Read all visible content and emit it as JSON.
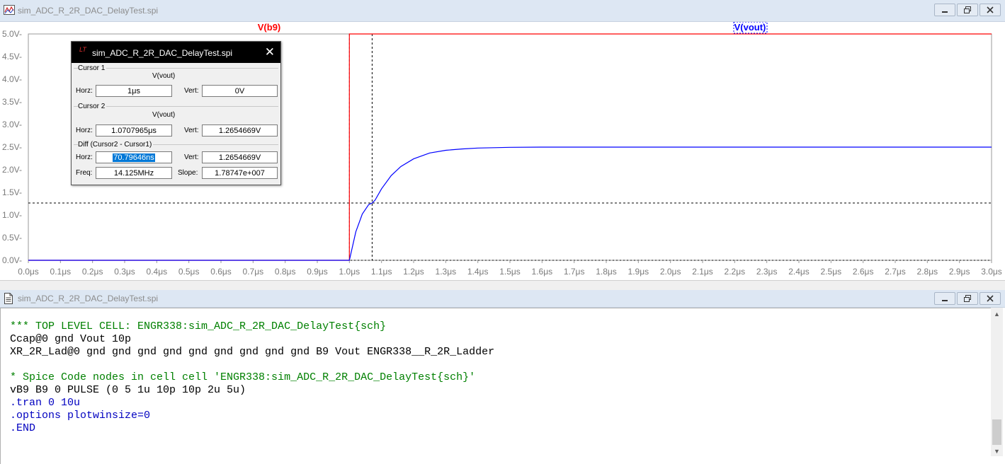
{
  "plot_window": {
    "title": "sim_ADC_R_2R_DAC_DelayTest.spi",
    "minimize_label": "—",
    "restore_label": "❐",
    "close_label": "✕"
  },
  "chart_data": {
    "type": "line",
    "title": "",
    "x_unit": "μs",
    "y_unit": "V",
    "xlim": [
      0.0,
      3.0
    ],
    "ylim": [
      0.0,
      5.0
    ],
    "x_ticks": [
      "0.0μs",
      "0.1μs",
      "0.2μs",
      "0.3μs",
      "0.4μs",
      "0.5μs",
      "0.6μs",
      "0.7μs",
      "0.8μs",
      "0.9μs",
      "1.0μs",
      "1.1μs",
      "1.2μs",
      "1.3μs",
      "1.4μs",
      "1.5μs",
      "1.6μs",
      "1.7μs",
      "1.8μs",
      "1.9μs",
      "2.0μs",
      "2.1μs",
      "2.2μs",
      "2.3μs",
      "2.4μs",
      "2.5μs",
      "2.6μs",
      "2.7μs",
      "2.8μs",
      "2.9μs",
      "3.0μs"
    ],
    "y_ticks": [
      "0.0V-",
      "0.5V-",
      "1.0V-",
      "1.5V-",
      "2.0V-",
      "2.5V-",
      "3.0V-",
      "3.5V-",
      "4.0V-",
      "4.5V-",
      "5.0V-"
    ],
    "series": [
      {
        "name": "V(b9)",
        "color": "#ff0000",
        "x": [
          0.0,
          1.0,
          1.0,
          3.0
        ],
        "y": [
          0.0,
          0.0,
          5.0,
          5.0
        ]
      },
      {
        "name": "V(vout)",
        "color": "#0000ff",
        "x": [
          0.0,
          1.0,
          1.02,
          1.04,
          1.06,
          1.0708,
          1.08,
          1.1,
          1.13,
          1.16,
          1.2,
          1.25,
          1.3,
          1.35,
          1.4,
          1.5,
          1.6,
          1.8,
          2.0,
          2.5,
          3.0
        ],
        "y": [
          0.0,
          0.0,
          0.63,
          1.02,
          1.23,
          1.265,
          1.33,
          1.58,
          1.87,
          2.07,
          2.24,
          2.37,
          2.43,
          2.46,
          2.48,
          2.495,
          2.5,
          2.5,
          2.5,
          2.5,
          2.5
        ]
      }
    ],
    "cursors": {
      "cursor1_x": 1.0,
      "cursor2_x": 1.0707965,
      "cursor2_y": 1.2654669
    }
  },
  "cursor_dialog": {
    "title": "sim_ADC_R_2R_DAC_DelayTest.spi",
    "close_label": "✕",
    "cursor1": {
      "label": "Cursor 1",
      "signal": "V(vout)",
      "horz_label": "Horz:",
      "horz": "1μs",
      "vert_label": "Vert:",
      "vert": "0V"
    },
    "cursor2": {
      "label": "Cursor 2",
      "signal": "V(vout)",
      "horz_label": "Horz:",
      "horz": "1.0707965μs",
      "vert_label": "Vert:",
      "vert": "1.2654669V"
    },
    "diff": {
      "label": "Diff (Cursor2 - Cursor1)",
      "horz_label": "Horz:",
      "horz": "70.79646ns",
      "vert_label": "Vert:",
      "vert": "1.2654669V",
      "freq_label": "Freq:",
      "freq": "14.125MHz",
      "slope_label": "Slope:",
      "slope": "1.78747e+007"
    }
  },
  "netlist_window": {
    "title": "sim_ADC_R_2R_DAC_DelayTest.spi",
    "lines": [
      {
        "text": "*** TOP LEVEL CELL: ENGR338:sim_ADC_R_2R_DAC_DelayTest{sch}",
        "color": "#008000"
      },
      {
        "text": "Ccap@0 gnd Vout 10p",
        "color": "#000000"
      },
      {
        "text": "XR_2R_Lad@0 gnd gnd gnd gnd gnd gnd gnd gnd gnd B9 Vout ENGR338__R_2R_Ladder",
        "color": "#000000"
      },
      {
        "text": "",
        "color": "#000000"
      },
      {
        "text": "* Spice Code nodes in cell cell 'ENGR338:sim_ADC_R_2R_DAC_DelayTest{sch}'",
        "color": "#008000"
      },
      {
        "text": "vB9 B9 0 PULSE (0 5 1u 10p 10p 2u 5u)",
        "color": "#000000"
      },
      {
        "text": ".tran 0 10u",
        "color": "#0000c0"
      },
      {
        "text": ".options plotwinsize=0",
        "color": "#0000c0"
      },
      {
        "text": ".END",
        "color": "#0000c0"
      }
    ],
    "scroll_up": "▲",
    "scroll_down": "▼"
  }
}
